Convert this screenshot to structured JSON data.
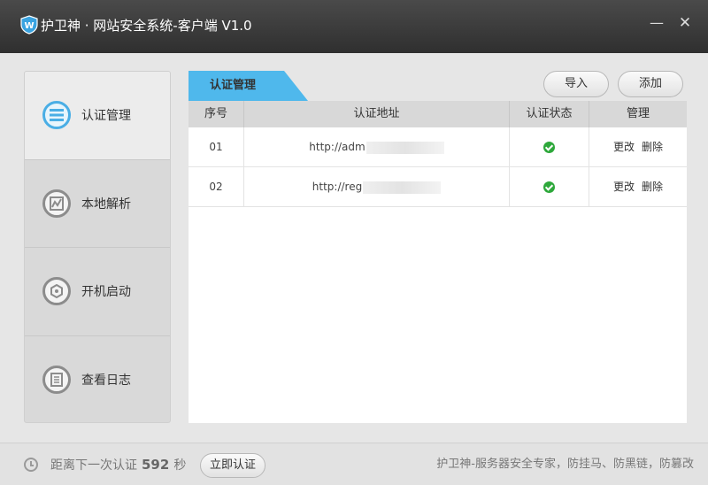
{
  "window": {
    "title": "护卫神 · 网站安全系统-客户端 V1.0",
    "minimize": "—",
    "close": "✕"
  },
  "sidebar": {
    "items": [
      {
        "label": "认证管理",
        "icon": "list-icon",
        "active": true
      },
      {
        "label": "本地解析",
        "icon": "chart-icon",
        "active": false
      },
      {
        "label": "开机启动",
        "icon": "hexagon-icon",
        "active": false
      },
      {
        "label": "查看日志",
        "icon": "document-icon",
        "active": false
      }
    ]
  },
  "content": {
    "tab": "认证管理",
    "import_label": "导入",
    "add_label": "添加",
    "columns": [
      "序号",
      "认证地址",
      "认证状态",
      "管理"
    ],
    "rows": [
      {
        "index": "01",
        "url": "http://adm",
        "status": "ok",
        "edit": "更改",
        "delete": "删除"
      },
      {
        "index": "02",
        "url": "http://reg",
        "status": "ok",
        "edit": "更改",
        "delete": "删除"
      }
    ]
  },
  "footer": {
    "countdown_prefix": "距离下一次认证",
    "countdown_value": "592",
    "countdown_unit": "秒",
    "auth_button": "立即认证",
    "slogan": "护卫神-服务器安全专家，防挂马、防黑链，防篡改"
  },
  "colors": {
    "accent": "#4fb8ec",
    "titlebar": "#3a3a3a",
    "status_ok": "#2ea83b"
  }
}
